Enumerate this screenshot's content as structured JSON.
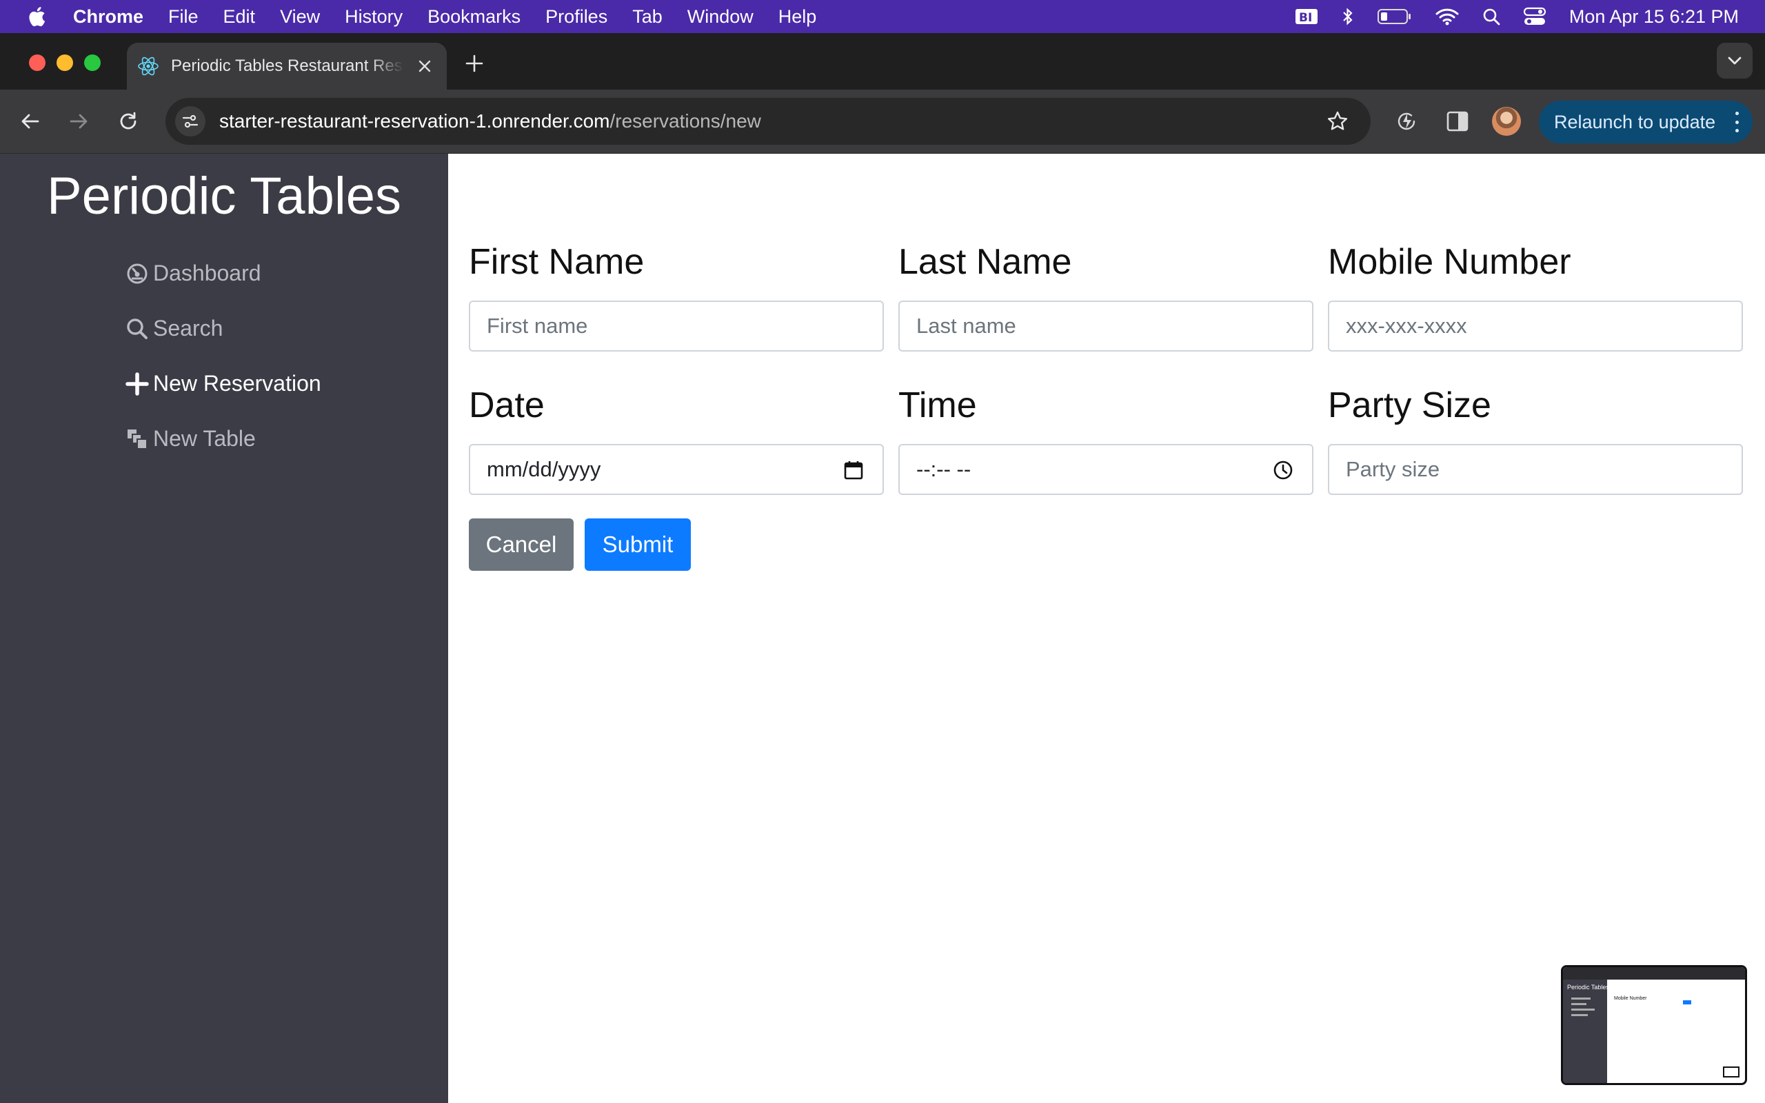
{
  "menubar": {
    "app": "Chrome",
    "items": [
      "File",
      "Edit",
      "View",
      "History",
      "Bookmarks",
      "Profiles",
      "Tab",
      "Window",
      "Help"
    ],
    "clock": "Mon Apr 15  6:21 PM",
    "status_icons": [
      "bi-icon",
      "bluetooth-icon",
      "battery-icon",
      "wifi-icon",
      "spotlight-search-icon",
      "control-center-icon"
    ]
  },
  "browser": {
    "tab_title": "Periodic Tables Restaurant Reservation",
    "url_host": "starter-restaurant-reservation-1.onrender.com",
    "url_path": "/reservations/new",
    "relaunch_label": "Relaunch to update"
  },
  "sidebar": {
    "brand": "Periodic Tables",
    "items": [
      {
        "label": "Dashboard",
        "icon": "dashboard-icon"
      },
      {
        "label": "Search",
        "icon": "search-icon"
      },
      {
        "label": "New Reservation",
        "icon": "plus-icon"
      },
      {
        "label": "New Table",
        "icon": "layers-icon"
      }
    ]
  },
  "form": {
    "first_name": {
      "label": "First Name",
      "placeholder": "First name"
    },
    "last_name": {
      "label": "Last Name",
      "placeholder": "Last name"
    },
    "mobile": {
      "label": "Mobile Number",
      "placeholder": "xxx-xxx-xxxx"
    },
    "date": {
      "label": "Date",
      "value": "mm/dd/yyyy"
    },
    "time": {
      "label": "Time",
      "value": "--:-- --"
    },
    "party_size": {
      "label": "Party Size",
      "placeholder": "Party size"
    },
    "cancel_label": "Cancel",
    "submit_label": "Submit"
  },
  "thumbnail": {
    "brand": "Periodic Tables",
    "label": "Mobile Number"
  },
  "colors": {
    "menubar": "#4a2aa8",
    "sidebar": "#3b3c46",
    "submit": "#0d7bff",
    "cancel": "#6c757d",
    "relaunch": "#0b4a73"
  }
}
